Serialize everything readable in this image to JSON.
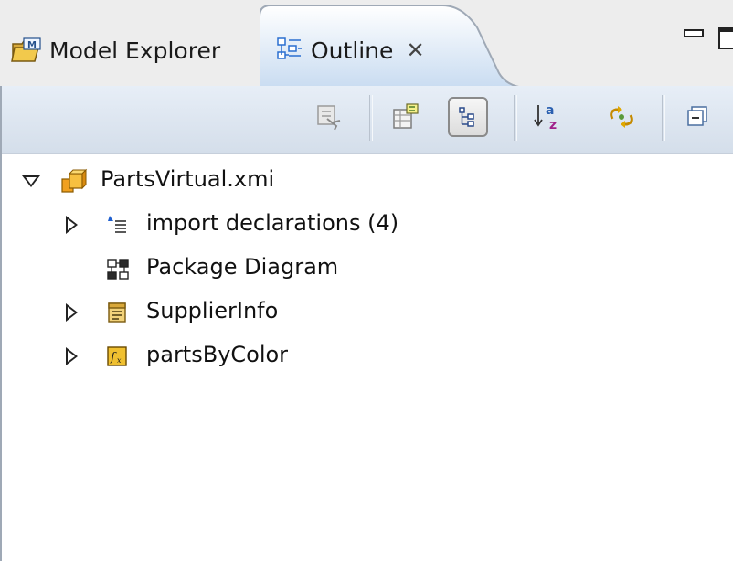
{
  "tabs": {
    "model_explorer": {
      "label": "Model Explorer",
      "icon": "model-explorer-icon"
    },
    "outline": {
      "label": "Outline",
      "icon": "outline-icon",
      "close_glyph": "✕",
      "active": true
    }
  },
  "window_controls": {
    "minimize": "minimize-icon",
    "maximize": "maximize-icon"
  },
  "toolbar": {
    "buttons": [
      {
        "name": "run-disabled-icon",
        "pressed": false
      },
      {
        "name": "table-icon",
        "pressed": false
      },
      {
        "name": "tree-view-icon",
        "pressed": true
      },
      {
        "name": "sort-alpha-icon",
        "pressed": false
      },
      {
        "name": "link-sync-icon",
        "pressed": false
      },
      {
        "name": "collapse-all-icon",
        "pressed": false
      }
    ]
  },
  "tree": {
    "root": {
      "label": "PartsVirtual.xmi",
      "icon": "model-package-icon",
      "expanded": true
    },
    "children": [
      {
        "label": "import declarations (4)",
        "icon": "import-declarations-icon",
        "expandable": true
      },
      {
        "label": "Package Diagram",
        "icon": "package-diagram-icon",
        "expandable": false
      },
      {
        "label": "SupplierInfo",
        "icon": "table-class-icon",
        "expandable": true
      },
      {
        "label": "partsByColor",
        "icon": "function-icon",
        "expandable": true
      }
    ]
  },
  "colors": {
    "tab_active": "#c9dcf1",
    "toolbar_bg": "#dce5f0",
    "panel_border": "#9fa9b6"
  }
}
